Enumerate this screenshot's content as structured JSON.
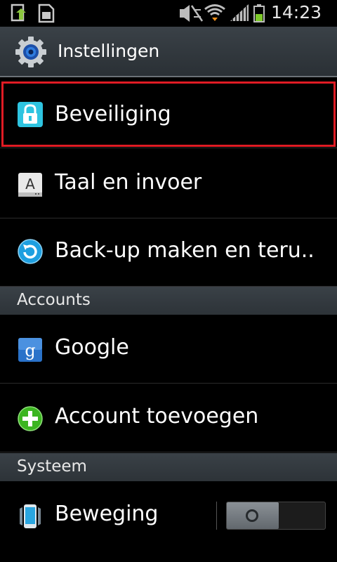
{
  "status_bar": {
    "time": "14:23"
  },
  "action_bar": {
    "title": "Instellingen",
    "icon": "settings-gear-icon"
  },
  "items": [
    {
      "label": "Beveiliging",
      "icon": "lock-icon",
      "selected": true
    },
    {
      "label": "Taal en invoer",
      "icon": "keyboard-a-icon"
    },
    {
      "label": "Back-up maken en teru..",
      "icon": "backup-restore-icon"
    }
  ],
  "sections": {
    "accounts": "Accounts",
    "systeem": "Systeem"
  },
  "accounts": [
    {
      "label": "Google",
      "icon": "google-icon"
    },
    {
      "label": "Account toevoegen",
      "icon": "add-account-icon"
    }
  ],
  "system": [
    {
      "label": "Beweging",
      "icon": "phone-motion-icon",
      "toggle_on": false
    }
  ],
  "colors": {
    "selection_outline": "#e01b24",
    "header_bg": "#3a4147",
    "battery": "#7ec92a"
  }
}
